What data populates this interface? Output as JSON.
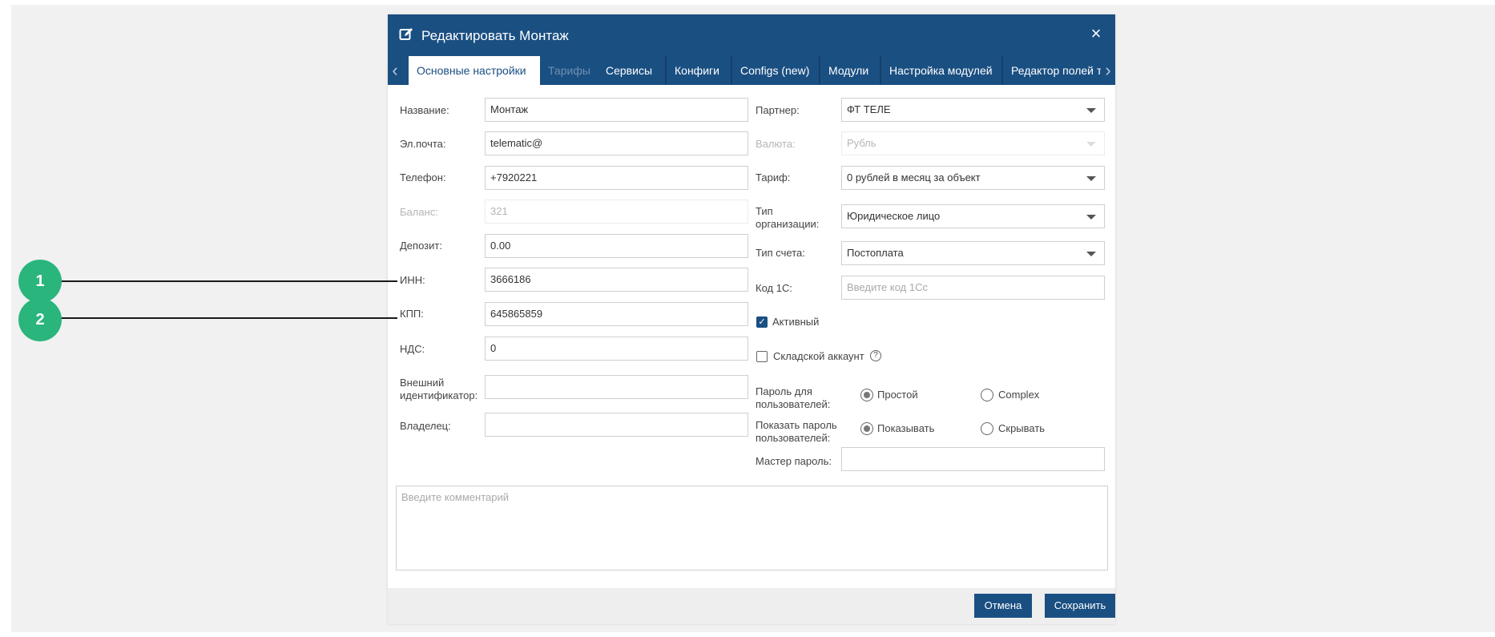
{
  "dialog": {
    "title": "Редактировать Монтаж",
    "close_icon": "close-icon",
    "tabs": [
      {
        "label": "Основные настройки",
        "state": "active"
      },
      {
        "label": "Тарифы",
        "state": "disabled"
      },
      {
        "label": "Сервисы",
        "state": "normal"
      },
      {
        "label": "Конфиги",
        "state": "normal"
      },
      {
        "label": "Configs (new)",
        "state": "normal"
      },
      {
        "label": "Модули",
        "state": "normal"
      },
      {
        "label": "Настройка модулей",
        "state": "normal"
      },
      {
        "label": "Редактор полей тр",
        "state": "normal"
      }
    ]
  },
  "form_left": {
    "name": {
      "label": "Название:",
      "value": "Монтаж"
    },
    "email": {
      "label": "Эл.почта:",
      "value": "telematic@"
    },
    "phone": {
      "label": "Телефон:",
      "value": "+7920221"
    },
    "balance": {
      "label": "Баланс:",
      "value": "321"
    },
    "deposit": {
      "label": "Депозит:",
      "value": "0.00"
    },
    "inn": {
      "label": "ИНН:",
      "value": "3666186"
    },
    "kpp": {
      "label": "КПП:",
      "value": "645865859"
    },
    "vat": {
      "label": "НДС:",
      "value": "0"
    },
    "external_id": {
      "label": "Внешний идентификатор:",
      "value": ""
    },
    "owner": {
      "label": "Владелец:",
      "value": ""
    }
  },
  "form_right": {
    "partner": {
      "label": "Партнер:",
      "value": "ФТ ТЕЛЕ"
    },
    "currency": {
      "label": "Валюта:",
      "value": "Рубль"
    },
    "tariff": {
      "label": "Тариф:",
      "value": "0 рублей в месяц за объект"
    },
    "org_type": {
      "label": "Тип организации:",
      "value": "Юридическое лицо"
    },
    "account_type": {
      "label": "Тип счета:",
      "value": "Постоплата"
    },
    "code_1c": {
      "label": "Код 1С:",
      "placeholder": "Введите код 1Сс"
    },
    "active": {
      "label": "Активный",
      "checked": true
    },
    "warehouse": {
      "label": "Складской аккаунт",
      "checked": false
    },
    "password_type": {
      "label": "Пароль для пользователей:",
      "options": [
        "Простой",
        "Complex"
      ],
      "selected": "Простой"
    },
    "show_password": {
      "label": "Показать пароль пользователей:",
      "options": [
        "Показывать",
        "Скрывать"
      ],
      "selected": "Показывать"
    },
    "master_password": {
      "label": "Мастер пароль:",
      "value": ""
    }
  },
  "comment": {
    "placeholder": "Введите комментарий"
  },
  "footer": {
    "cancel_label": "Отмена",
    "save_label": "Сохранить"
  },
  "callouts": [
    "1",
    "2"
  ],
  "colors": {
    "primary": "#1a4f82",
    "callout": "#2ab57d"
  }
}
